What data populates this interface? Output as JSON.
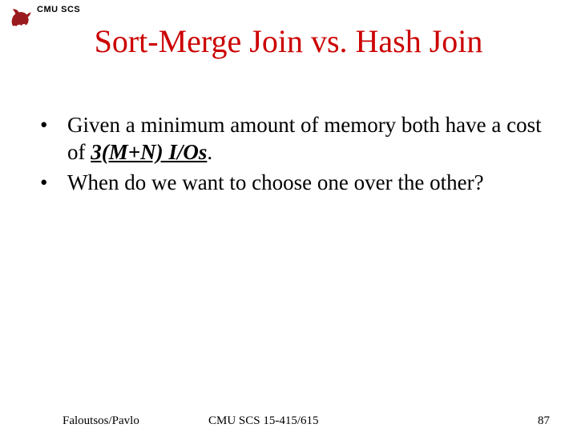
{
  "header": {
    "dept_label": "CMU SCS"
  },
  "title": "Sort-Merge Join vs. Hash Join",
  "bullets": [
    {
      "pre": "Given a minimum amount of memory both have a cost of ",
      "emph": "3(M+N) I/Os",
      "post": "."
    },
    {
      "pre": "When do we want to choose one over the other?",
      "emph": "",
      "post": ""
    }
  ],
  "footer": {
    "left": "Faloutsos/Pavlo",
    "center": "CMU SCS 15-415/615",
    "right": "87"
  }
}
